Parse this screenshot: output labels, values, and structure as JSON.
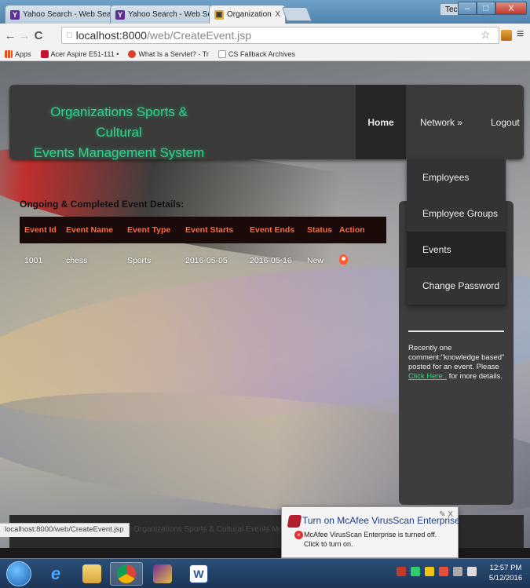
{
  "browser": {
    "tabs": [
      {
        "title": "Yahoo Search - Web Sear",
        "fav": "Y"
      },
      {
        "title": "Yahoo Search - Web Sear",
        "fav": "Y"
      },
      {
        "title": "Organizations Sports & C",
        "fav": "▣"
      }
    ],
    "close_glyph": "X",
    "user_label": "Technical",
    "window_buttons": {
      "minimize": "–",
      "maximize": "□",
      "close": "X"
    },
    "url_host": "localhost:8000",
    "url_path": "/web/CreateEvent.jsp",
    "bookmarks": [
      {
        "label": "Apps",
        "color": "#e94e1b"
      },
      {
        "label": "Acer Aspire E51-111 •",
        "color": "#c8102e"
      },
      {
        "label": "What Is a Servlet? - Tr",
        "color": "#d9412b"
      },
      {
        "label": "CS Fallback Archives",
        "color": "#ffffff"
      }
    ]
  },
  "site": {
    "logo_line1": "Organizations Sports & Cultural",
    "logo_line2": "Events Management System",
    "nav": {
      "home": "Home",
      "network": "Network »",
      "logout": "Logout"
    },
    "dropdown": [
      "Employees",
      "Employee Groups",
      "Events",
      "Change Password"
    ],
    "section_title": "Ongoing & Completed Event Details:",
    "table": {
      "headers": [
        "Event Id",
        "Event Name",
        "Event Type",
        "Event Starts",
        "Event Ends",
        "Status",
        "Action"
      ],
      "rows": [
        [
          "1001",
          "chess",
          "Sports",
          "2016-05-05",
          "2016-05-16",
          "New"
        ]
      ]
    },
    "sidebar": {
      "text_before": "Recently one comment:\"knowledge based\" posted for an event. Please",
      "link": "Click Here..",
      "text_after": "for more details."
    },
    "footer": "© Organizations Sports & Cultural Events Manag"
  },
  "status_url": "localhost:8000/web/CreateEvent.jsp",
  "notification": {
    "title": "Turn on McAfee VirusScan Enterprise",
    "body": "McAfee VirusScan Enterprise is turned off. Click to turn on.",
    "controls": "✎  X"
  },
  "taskbar": {
    "time": "12:57 PM",
    "date": "5/12/2016"
  },
  "colors": {
    "logo_green": "#2ad68a",
    "table_header_text": "#ff6a3d",
    "link_green": "#35d57f"
  }
}
